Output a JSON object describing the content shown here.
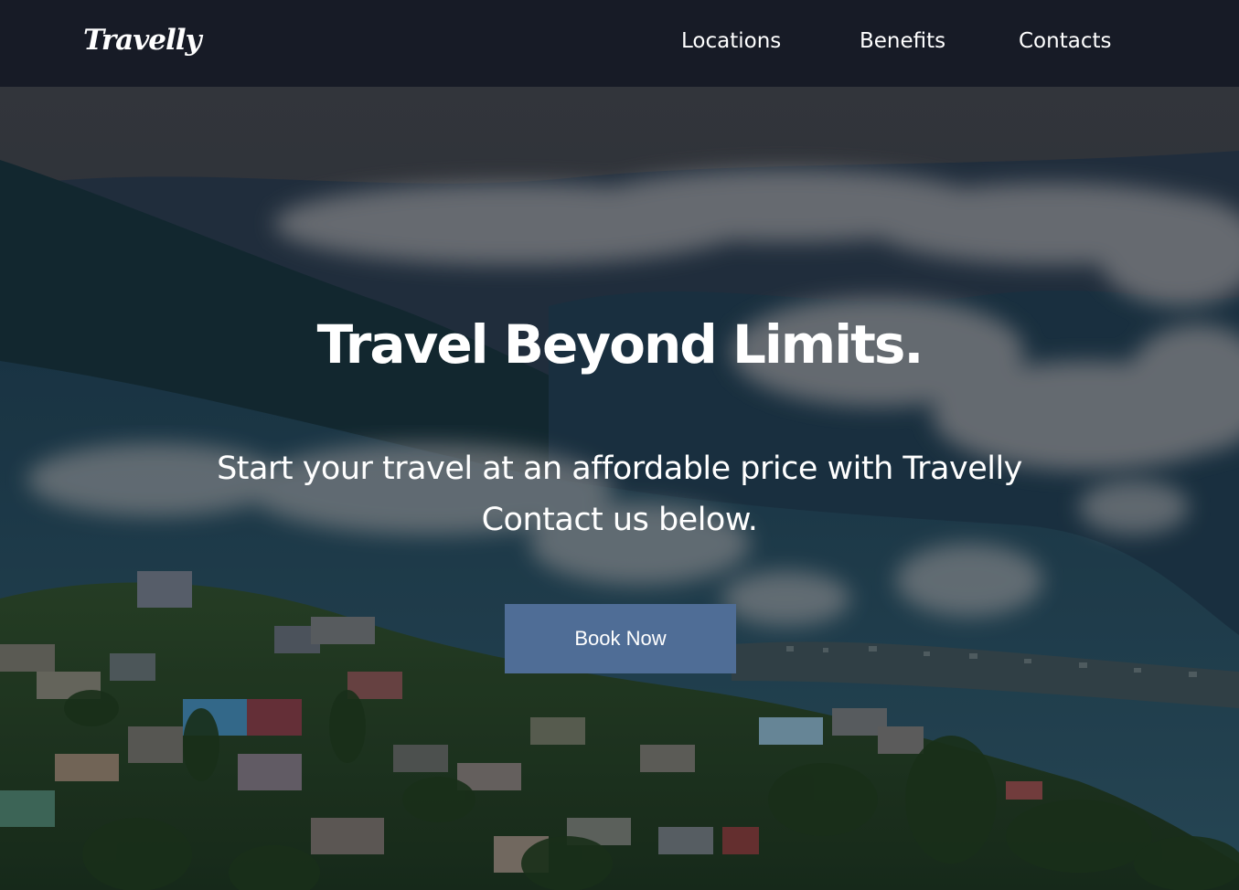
{
  "navbar": {
    "logo": "Travelly",
    "links": [
      {
        "label": "Locations"
      },
      {
        "label": "Benefits"
      },
      {
        "label": "Contacts"
      }
    ]
  },
  "hero": {
    "title": "Travel Beyond Limits.",
    "subtitle_line1": "Start your travel at an affordable price with Travelly",
    "subtitle_line2": "Contact us below.",
    "button_label": "Book Now"
  },
  "colors": {
    "navbar_bg": "#171b26",
    "button_bg": "#4f6d96",
    "text": "#ffffff"
  }
}
